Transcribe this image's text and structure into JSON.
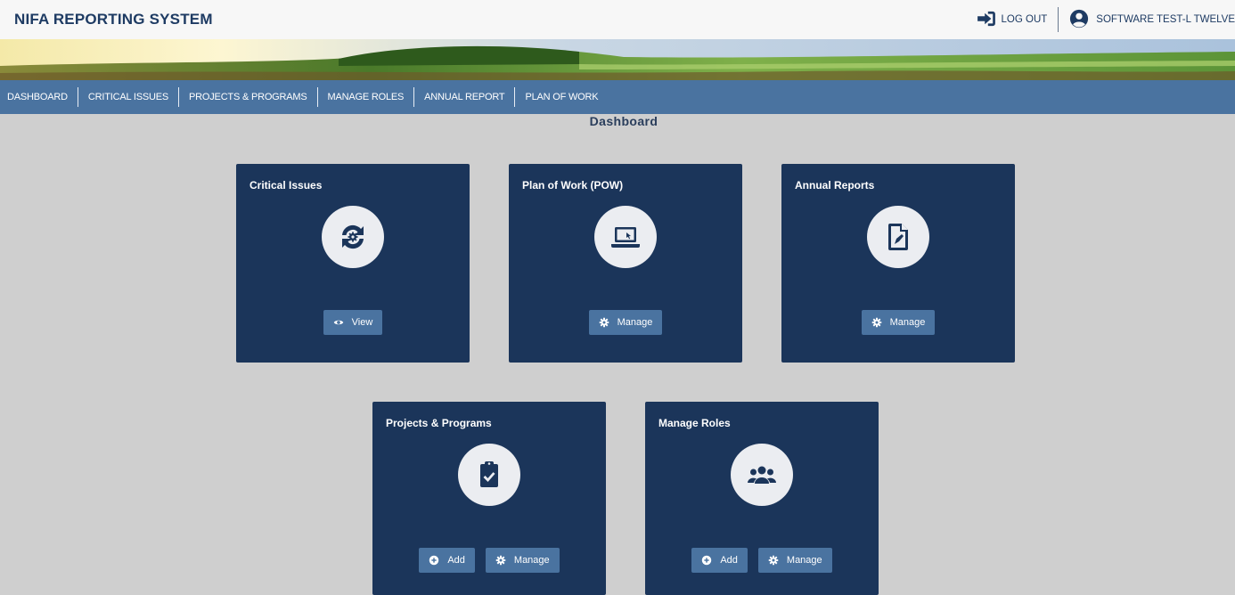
{
  "header": {
    "app_title": "NIFA REPORTING SYSTEM",
    "logout_label": "LOG OUT",
    "user_name": "SOFTWARE TEST-L TWELVE"
  },
  "nav": {
    "items": [
      "DASHBOARD",
      "CRITICAL ISSUES",
      "PROJECTS & PROGRAMS",
      "MANAGE ROLES",
      "ANNUAL REPORT",
      "PLAN OF WORK"
    ]
  },
  "page": {
    "title": "Dashboard"
  },
  "cards": {
    "critical_issues": {
      "title": "Critical Issues",
      "icon": "sync-gear-icon",
      "view_label": "View"
    },
    "plan_of_work": {
      "title": "Plan of Work (POW)",
      "icon": "laptop-icon",
      "manage_label": "Manage"
    },
    "annual_reports": {
      "title": "Annual Reports",
      "icon": "file-signature-icon",
      "manage_label": "Manage"
    },
    "projects_programs": {
      "title": "Projects & Programs",
      "icon": "clipboard-check-icon",
      "add_label": "Add",
      "manage_label": "Manage"
    },
    "manage_roles": {
      "title": "Manage Roles",
      "icon": "users-icon",
      "add_label": "Add",
      "manage_label": "Manage"
    }
  },
  "colors": {
    "card_bg": "#1b355a",
    "nav_bg": "#4a73a0",
    "button_bg": "#4a73a0",
    "page_bg": "#cfcfcf",
    "title_color": "#1e3b63"
  }
}
